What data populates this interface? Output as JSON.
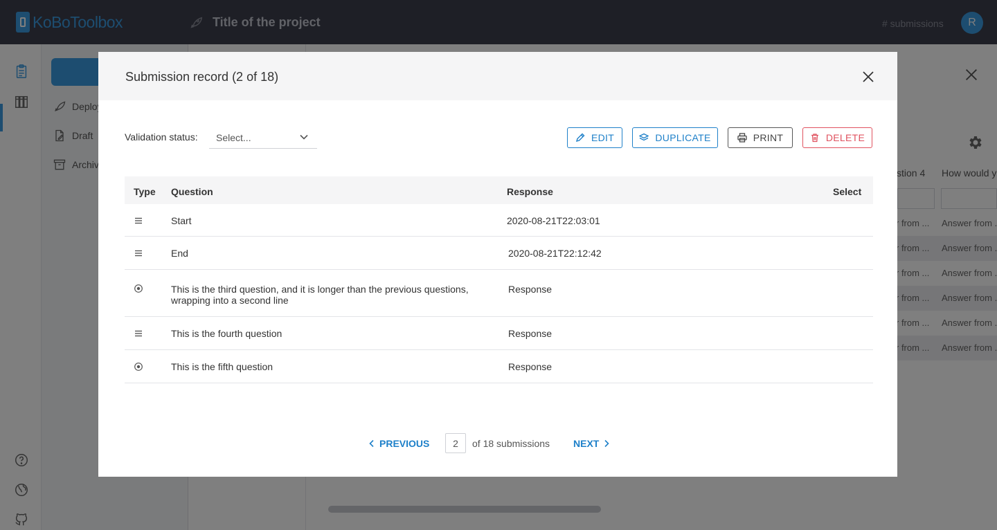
{
  "app": {
    "logo_primary": "KoBo",
    "logo_secondary": "Toolbox",
    "project_title": "Title of the project",
    "submissions_label": "# submissions",
    "avatar_initial": "R"
  },
  "sidebar": {
    "items": [
      {
        "label": "Deploy",
        "icon": "rocket-icon"
      },
      {
        "label": "Draft",
        "icon": "draft-icon"
      },
      {
        "label": "Archiv",
        "icon": "archive-icon"
      }
    ]
  },
  "background_table": {
    "headers": [
      "stion 4",
      "How would y"
    ],
    "cells": [
      [
        "r from ...",
        "Answer from ."
      ],
      [
        "r from ...",
        "Answer from ."
      ],
      [
        "r from ...",
        "Answer from ."
      ],
      [
        "r from ...",
        "Answer from ."
      ],
      [
        "r from ...",
        "Answer from ."
      ],
      [
        "r from ...",
        "Answer from ."
      ]
    ]
  },
  "modal": {
    "title": "Submission record (2 of 18)",
    "validation_label": "Validation status:",
    "validation_placeholder": "Select...",
    "buttons": {
      "edit": "EDIT",
      "duplicate": "DUPLICATE",
      "print": "PRINT",
      "delete": "DELETE"
    },
    "table": {
      "headers": {
        "type": "Type",
        "question": "Question",
        "response": "Response",
        "select": "Select"
      },
      "rows": [
        {
          "type_icon": "text-lines-icon",
          "question": "Start",
          "response": "2020-08-21T22:03:01"
        },
        {
          "type_icon": "text-lines-icon",
          "question": "End",
          "response": "2020-08-21T22:12:42"
        },
        {
          "type_icon": "radio-select-icon",
          "question": "This is the third question, and it is longer than the previous questions, wrapping into a second line",
          "response": "Response"
        },
        {
          "type_icon": "text-lines-icon",
          "question": "This is the fourth question",
          "response": "Response"
        },
        {
          "type_icon": "radio-select-icon",
          "question": "This is the fifth question",
          "response": "Response"
        }
      ]
    },
    "pager": {
      "previous": "PREVIOUS",
      "current_page": "2",
      "of_label": "of 18 submissions",
      "next": "NEXT"
    }
  },
  "colors": {
    "header_bg": "#3d3f4d",
    "accent": "#1e80c9",
    "danger": "#e0525f",
    "overlay": "rgba(0,0,0,0.5)"
  }
}
